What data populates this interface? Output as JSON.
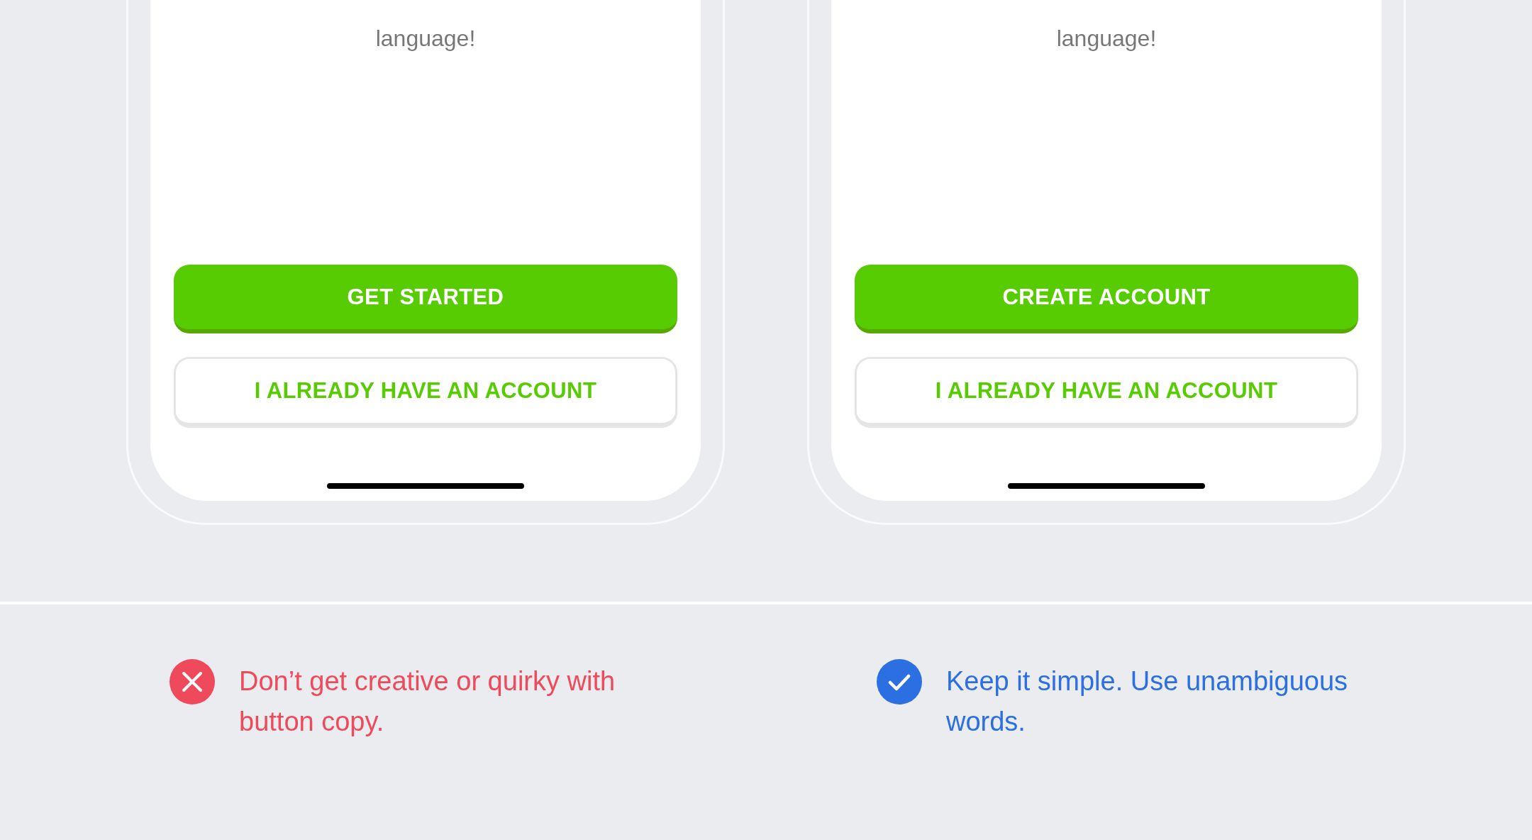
{
  "examples": [
    {
      "screen": {
        "tagline": "language!",
        "primary_button": "GET STARTED",
        "secondary_button": "I ALREADY HAVE AN ACCOUNT"
      }
    },
    {
      "screen": {
        "tagline": "language!",
        "primary_button": "CREATE ACCOUNT",
        "secondary_button": "I ALREADY HAVE AN ACCOUNT"
      }
    }
  ],
  "guidelines": [
    {
      "kind": "dont",
      "text": "Don’t get creative or quirky with button copy."
    },
    {
      "kind": "do",
      "text": "Keep it simple. Use unambiguous words."
    }
  ]
}
